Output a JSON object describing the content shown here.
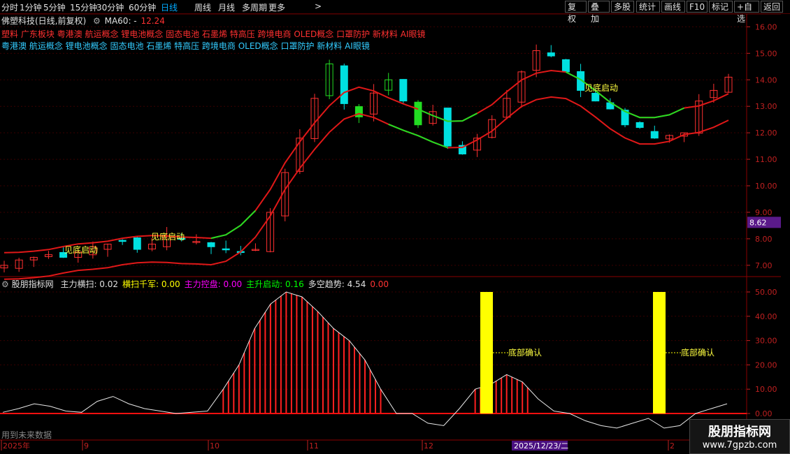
{
  "toolbar": {
    "left_tabs": [
      "分时",
      "1分钟",
      "5分钟",
      "15分钟",
      "30分钟",
      "60分钟",
      "日线",
      "周线",
      "月线",
      "多周期",
      "更多"
    ],
    "active_tab": "日线",
    "more_arrow": ">",
    "right_buttons": [
      "复权",
      "叠加",
      "多股",
      "统计",
      "画线",
      "F10",
      "标记",
      "+自选",
      "返回"
    ]
  },
  "main_header": {
    "title": "佛塑科技(日线,前复权)",
    "ma_label": "MA60: -",
    "ma_value": "12.24"
  },
  "concepts_row1": "塑料 广东板块 粤港澳 航运概念 锂电池概念 固态电池 石墨烯 特高压 跨境电商 OLED概念 口罩防护 新材料 AI眼镜",
  "concepts_row2": "粤港澳 航运概念 锂电池概念 固态电池 石墨烯 特高压 跨境电商 OLED概念 口罩防护 新材料 AI眼镜",
  "price_axis": {
    "ticks": [
      "16.00",
      "15.00",
      "14.00",
      "13.00",
      "12.00",
      "11.00",
      "10.00",
      "9.00",
      "8.00",
      "7.00"
    ],
    "highlight": "8.62",
    "highlight_color": "#5a1a8a"
  },
  "annotations": {
    "bottom_start": "见底启动",
    "bottom_confirm": "底部确认"
  },
  "indicator_header": {
    "name": "股朋指标网",
    "items": [
      {
        "label": "主力横扫:",
        "value": "0.02",
        "color": "#e0e0e0"
      },
      {
        "label": "横扫千军:",
        "value": "0.00",
        "color": "#ffff00"
      },
      {
        "label": "主力控盘:",
        "value": "0.00",
        "color": "#ff00ff"
      },
      {
        "label": "主升启动:",
        "value": "0.16",
        "color": "#00ff00"
      },
      {
        "label": "多空趋势:",
        "value": "4.54",
        "color": "#e0e0e0"
      },
      {
        "label": "",
        "value": "0.00",
        "color": "#ff3333"
      }
    ]
  },
  "indicator_axis": {
    "ticks": [
      "50.00",
      "40.00",
      "30.00",
      "20.00",
      "10.00",
      "0.00"
    ]
  },
  "future_data_text": "用到未来数据",
  "date_axis": {
    "labels": [
      "2025年",
      "9",
      "10",
      "11",
      "12",
      "2"
    ],
    "highlight": "2025/12/23/二"
  },
  "logo": {
    "name": "股朋指标网",
    "url": "www.7gpzb.com"
  },
  "chart_data": [
    {
      "type": "candlestick",
      "title": "佛塑科技(日线,前复权)",
      "y_range": [
        6.6,
        16.3
      ],
      "series": [
        {
          "name": "MA60",
          "last": "12.24"
        }
      ],
      "approx_closes": [
        7.0,
        7.2,
        7.3,
        7.4,
        7.3,
        7.5,
        7.7,
        7.8,
        7.9,
        7.6,
        7.8,
        8.1,
        8.0,
        7.9,
        7.7,
        7.6,
        7.5,
        7.6,
        9.0,
        10.5,
        11.8,
        13.3,
        14.6,
        13.1,
        12.6,
        13.5,
        14.0,
        13.2,
        12.3,
        12.8,
        11.5,
        11.2,
        11.8,
        12.5,
        13.3,
        14.3,
        15.1,
        14.9,
        14.3,
        13.6,
        13.2,
        12.9,
        12.3,
        12.2,
        11.8,
        11.9,
        12.0,
        13.2,
        13.6,
        14.1
      ]
    },
    {
      "type": "bar",
      "title": "股朋指标网",
      "y_range": [
        0,
        53
      ],
      "series": [
        {
          "name": "多空趋势",
          "values": [
            0.5,
            2,
            4,
            3,
            1,
            0.5,
            5,
            7,
            4,
            2,
            1,
            0,
            0.5,
            1,
            10,
            20,
            35,
            45,
            50,
            48,
            42,
            35,
            30,
            22,
            10,
            0,
            0,
            -4,
            -5,
            2,
            10,
            12,
            16,
            13,
            6,
            1,
            0,
            -3,
            -5,
            -6,
            -4,
            -2,
            -6,
            -5,
            0,
            2,
            4
          ]
        },
        {
          "name": "底部确认",
          "values": [
            50,
            50
          ]
        }
      ]
    }
  ]
}
